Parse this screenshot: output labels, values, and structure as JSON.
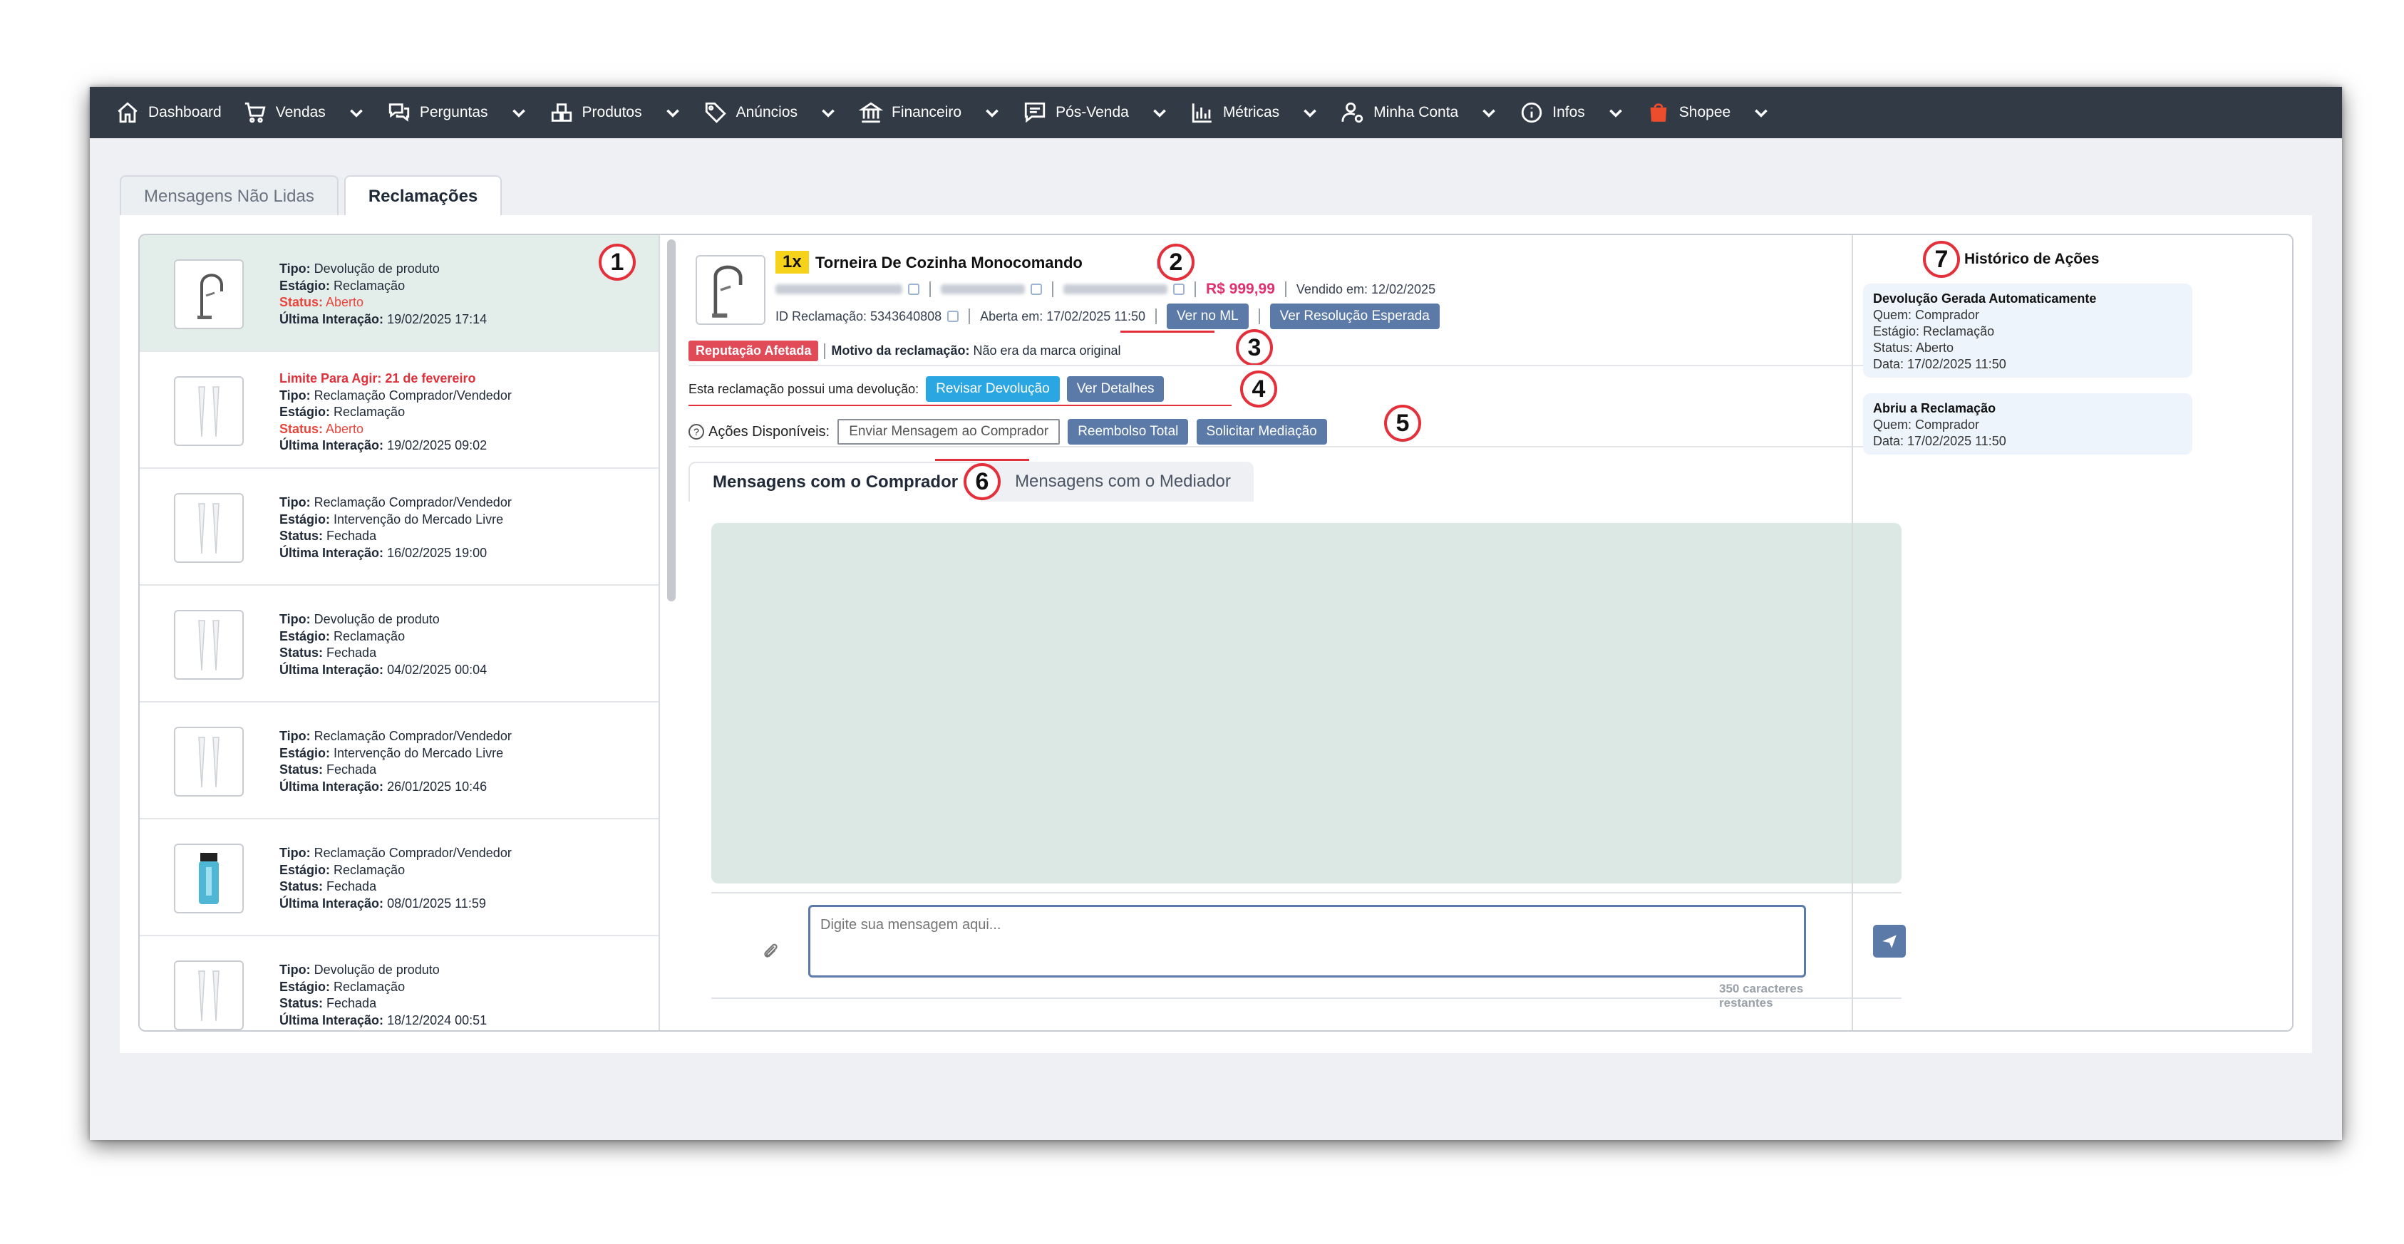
{
  "nav": {
    "items": [
      {
        "label": "Dashboard",
        "icon": "home-icon",
        "dropdown": false
      },
      {
        "label": "Vendas",
        "icon": "cart-icon",
        "dropdown": true
      },
      {
        "label": "Perguntas",
        "icon": "chat-bubbles-icon",
        "dropdown": true
      },
      {
        "label": "Produtos",
        "icon": "boxes-icon",
        "dropdown": true
      },
      {
        "label": "Anúncios",
        "icon": "tag-icon",
        "dropdown": true
      },
      {
        "label": "Financeiro",
        "icon": "bank-icon",
        "dropdown": true
      },
      {
        "label": "Pós-Venda",
        "icon": "message-square-icon",
        "dropdown": true
      },
      {
        "label": "Métricas",
        "icon": "bar-chart-icon",
        "dropdown": true
      },
      {
        "label": "Minha Conta",
        "icon": "user-gear-icon",
        "dropdown": true
      },
      {
        "label": "Infos",
        "icon": "info-circle-icon",
        "dropdown": true
      },
      {
        "label": "Shopee",
        "icon": "shopee-bag-icon",
        "dropdown": true
      }
    ]
  },
  "outer_tabs": [
    "Mensagens Não Lidas",
    "Reclamações"
  ],
  "annotations": [
    "1",
    "2",
    "3",
    "4",
    "5",
    "6",
    "7"
  ],
  "claims": [
    {
      "limit": "",
      "tipo": "Devolução de produto",
      "estagio": "Reclamação",
      "status": "Aberto",
      "status_red": true,
      "ultima": "19/02/2025 17:14",
      "thumb": "faucet"
    },
    {
      "limit": "Limite Para Agir: 21 de fevereiro",
      "tipo": "Reclamação Comprador/Vendedor",
      "estagio": "Reclamação",
      "status": "Aberto",
      "status_red": true,
      "ultima": "19/02/2025 09:02",
      "thumb": "legs"
    },
    {
      "limit": "",
      "tipo": "Reclamação Comprador/Vendedor",
      "estagio": "Intervenção do Mercado Livre",
      "status": "Fechada",
      "status_red": false,
      "ultima": "16/02/2025 19:00",
      "thumb": "legs"
    },
    {
      "limit": "",
      "tipo": "Devolução de produto",
      "estagio": "Reclamação",
      "status": "Fechada",
      "status_red": false,
      "ultima": "04/02/2025 00:04",
      "thumb": "legs"
    },
    {
      "limit": "",
      "tipo": "Reclamação Comprador/Vendedor",
      "estagio": "Intervenção do Mercado Livre",
      "status": "Fechada",
      "status_red": false,
      "ultima": "26/01/2025 10:46",
      "thumb": "legs"
    },
    {
      "limit": "",
      "tipo": "Reclamação Comprador/Vendedor",
      "estagio": "Reclamação",
      "status": "Fechada",
      "status_red": false,
      "ultima": "08/01/2025 11:59",
      "thumb": "bottle"
    },
    {
      "limit": "",
      "tipo": "Devolução de produto",
      "estagio": "Reclamação",
      "status": "Fechada",
      "status_red": false,
      "ultima": "18/12/2024 00:51",
      "thumb": "legs"
    }
  ],
  "labels": {
    "tipo": "Tipo:",
    "estagio": "Estágio:",
    "status": "Status:",
    "ultima": "Última Interação:"
  },
  "detail": {
    "qty": "1x",
    "title": "Torneira De Cozinha Monocomando",
    "price": "R$ 999,99",
    "sold": "Vendido em: 12/02/2025",
    "claim_id": "ID Reclamação: 5343640808",
    "opened": "Aberta em: 17/02/2025 11:50",
    "btn_ver_ml": "Ver no ML",
    "btn_resolucao": "Ver Resolução Esperada",
    "rep_tag": "Reputação Afetada",
    "motivo_label": "Motivo da reclamação:",
    "motivo": "Não era da marca original",
    "devolucao_text": "Esta reclamação possui uma devolução:",
    "btn_revisar": "Revisar Devolução",
    "btn_detalhes": "Ver Detalhes",
    "acoes_label": "Ações Disponíveis:",
    "btn_enviar": "Enviar Mensagem ao Comprador",
    "btn_reembolso": "Reembolso Total",
    "btn_mediacao": "Solicitar Mediação",
    "tab_comprador": "Mensagens com o Comprador",
    "tab_mediador": "Mensagens com o Mediador",
    "input_placeholder": "Digite sua mensagem aqui...",
    "remaining": "350 caracteres restantes"
  },
  "history": {
    "title": "Histórico de Ações",
    "entries": [
      {
        "title": "Devolução Gerada Automaticamente",
        "lines": [
          "Quem: Comprador",
          "Estágio: Reclamação",
          "Status: Aberto",
          "Data: 17/02/2025 11:50"
        ]
      },
      {
        "title": "Abriu a Reclamação",
        "lines": [
          "Quem: Comprador",
          "Data: 17/02/2025 11:50"
        ]
      }
    ]
  },
  "colors": {
    "nav_bg": "#323a45",
    "accent": "#5b7aa8",
    "annotation": "#e3303a",
    "price": "#e0306f",
    "qty_badge": "#f7d21b"
  }
}
